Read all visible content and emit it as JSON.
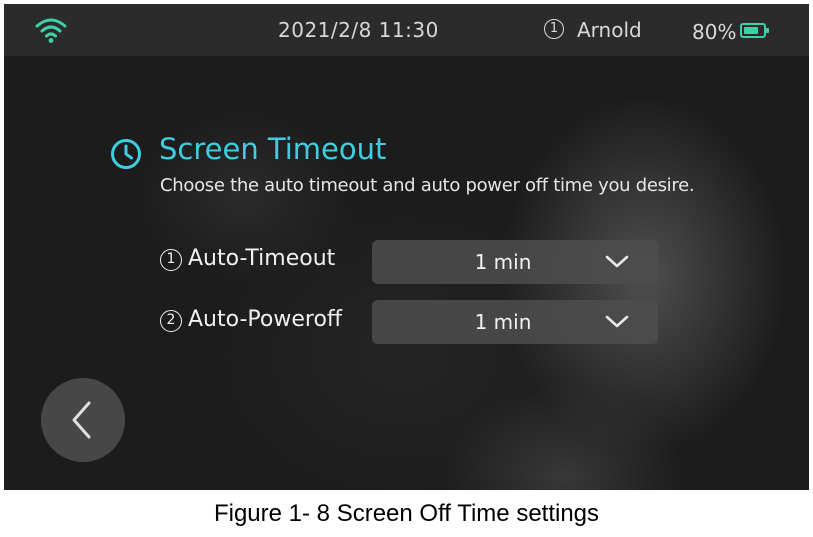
{
  "status_bar": {
    "datetime": "2021/2/8   11:30",
    "user_icon_glyph": "1",
    "user_name": "Arnold",
    "battery_text": "80%",
    "battery_level": 0.8,
    "icons": [
      "wifi-icon",
      "user-icon",
      "battery-icon"
    ],
    "accent_color": "#3fd0a8"
  },
  "screen_timeout": {
    "icon": "clock-icon",
    "title": "Screen Timeout",
    "description": "Choose the auto timeout and auto power off time you desire.",
    "title_color": "#3fcde0",
    "settings": [
      {
        "number": "1",
        "label": "Auto-Timeout",
        "value": "1 min"
      },
      {
        "number": "2",
        "label": "Auto-Poweroff",
        "value": "1 min"
      }
    ]
  },
  "navigation": {
    "back_icon": "chevron-left-icon"
  },
  "caption": "Figure 1- 8 Screen Off Time settings"
}
